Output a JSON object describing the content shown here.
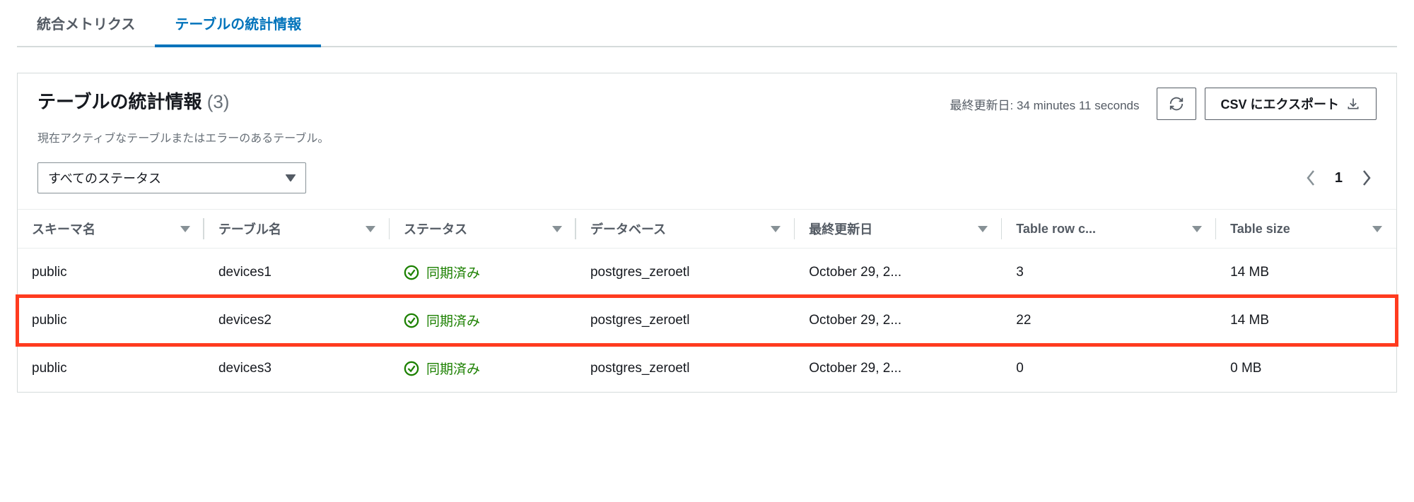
{
  "tabs": {
    "metrics": "統合メトリクス",
    "table_stats": "テーブルの統計情報"
  },
  "panel": {
    "title": "テーブルの統計情報",
    "count": "(3)",
    "subtitle": "現在アクティブなテーブルまたはエラーのあるテーブル。",
    "last_updated_label": "最終更新日:",
    "last_updated_value": "34 minutes 11 seconds",
    "export_label": "CSV にエクスポート"
  },
  "filter": {
    "selected": "すべてのステータス"
  },
  "pagination": {
    "page": "1"
  },
  "columns": {
    "schema": "スキーマ名",
    "table": "テーブル名",
    "status": "ステータス",
    "database": "データベース",
    "updated": "最終更新日",
    "rowcount": "Table row c...",
    "size": "Table size"
  },
  "status_synced": "同期済み",
  "rows": [
    {
      "schema": "public",
      "table": "devices1",
      "database": "postgres_zeroetl",
      "updated": "October 29, 2...",
      "rowcount": "3",
      "size": "14 MB"
    },
    {
      "schema": "public",
      "table": "devices2",
      "database": "postgres_zeroetl",
      "updated": "October 29, 2...",
      "rowcount": "22",
      "size": "14 MB"
    },
    {
      "schema": "public",
      "table": "devices3",
      "database": "postgres_zeroetl",
      "updated": "October 29, 2...",
      "rowcount": "0",
      "size": "0 MB"
    }
  ]
}
